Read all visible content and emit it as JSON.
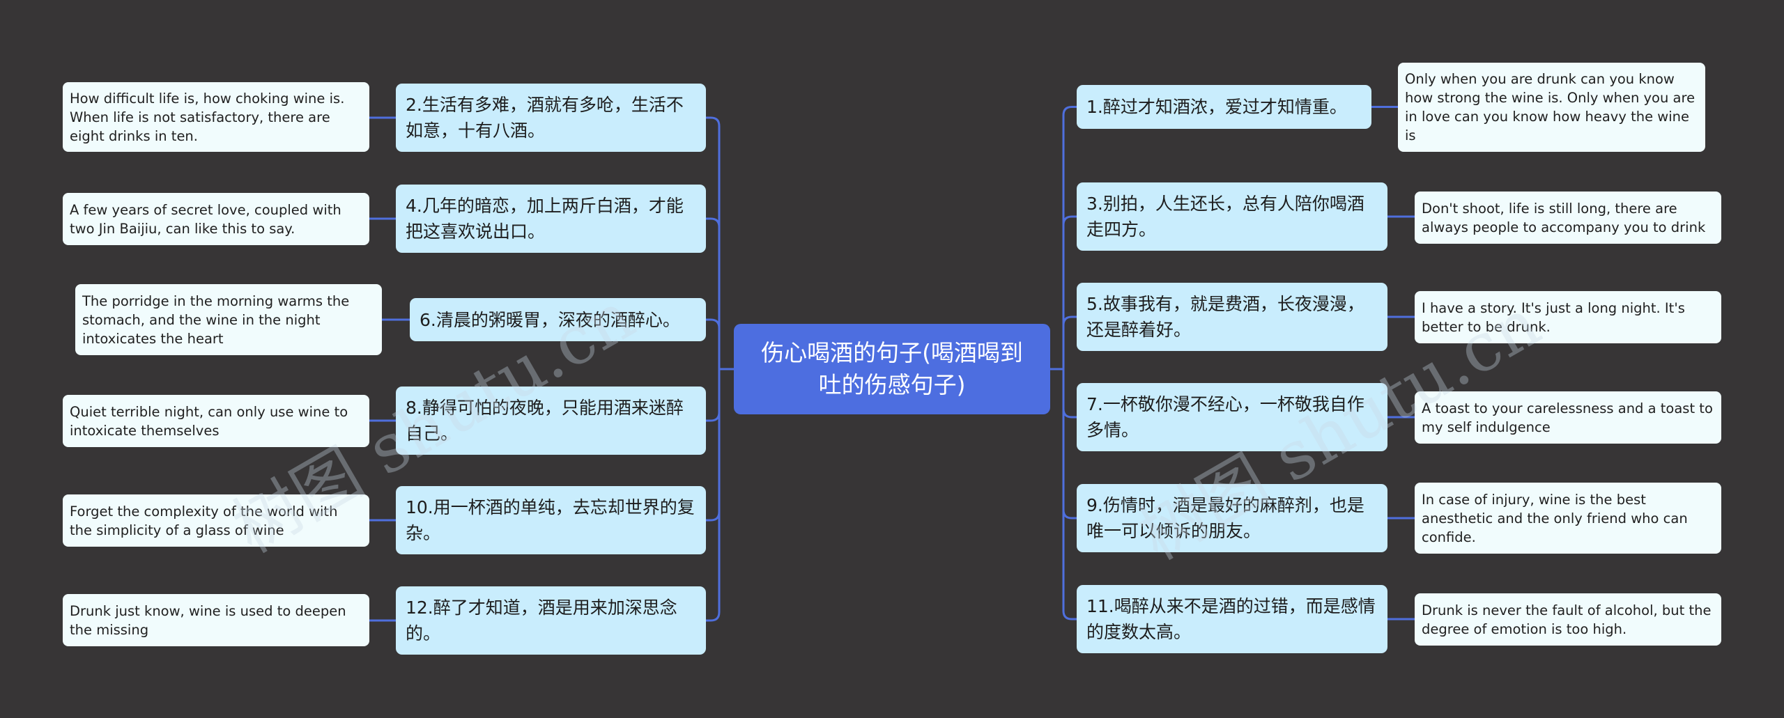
{
  "root": {
    "title": "伤心喝酒的句子(喝酒喝到吐的伤感句子)"
  },
  "left": [
    {
      "zh": "2.生活有多难，酒就有多呛，生活不如意，十有八酒。",
      "en": "How difficult life is, how choking wine is. When life is not satisfactory, there are eight drinks in ten."
    },
    {
      "zh": "4.几年的暗恋，加上两斤白酒，才能把这喜欢说出口。",
      "en": "A few years of secret love, coupled with two Jin Baijiu, can like this to say."
    },
    {
      "zh": "6.清晨的粥暖胃，深夜的酒醉心。",
      "en": "The porridge in the morning warms the stomach, and the wine in the night intoxicates the heart"
    },
    {
      "zh": "8.静得可怕的夜晚，只能用酒来迷醉自己。",
      "en": "Quiet terrible night, can only use wine to intoxicate themselves"
    },
    {
      "zh": "10.用一杯酒的单纯，去忘却世界的复杂。",
      "en": "Forget the complexity of the world with the simplicity of a glass of wine"
    },
    {
      "zh": "12.醉了才知道，酒是用来加深思念的。",
      "en": "Drunk just know, wine is used to deepen the missing"
    }
  ],
  "right": [
    {
      "zh": "1.醉过才知酒浓，爱过才知情重。",
      "en": "Only when you are drunk can you know how strong the wine is. Only when you are  in love can you know how heavy the wine is"
    },
    {
      "zh": "3.别拍，人生还长，总有人陪你喝酒走四方。",
      "en": "Don't shoot, life is still long, there are always people to accompany you to drink"
    },
    {
      "zh": "5.故事我有，就是费酒，长夜漫漫，还是醉着好。",
      "en": "I have a story. It's just a long night. It's better to be drunk."
    },
    {
      "zh": "7.一杯敬你漫不经心，一杯敬我自作多情。",
      "en": "A toast to your carelessness and a toast to my self indulgence"
    },
    {
      "zh": "9.伤情时，酒是最好的麻醉剂，也是唯一可以倾诉的朋友。",
      "en": "In case of injury, wine is the best anesthetic and the only friend who can confide."
    },
    {
      "zh": "11.喝醉从来不是酒的过错，而是感情的度数太高。",
      "en": "Drunk is never the fault of alcohol, but the  degree of emotion is too high."
    }
  ],
  "watermark": {
    "text": "树图 shutu.cn"
  },
  "colors": {
    "background": "#373536",
    "root": "#4D6EE0",
    "connector": "#4F6FDD",
    "zh_node": "#C9EDFD",
    "en_node": "#F1FCFD"
  }
}
